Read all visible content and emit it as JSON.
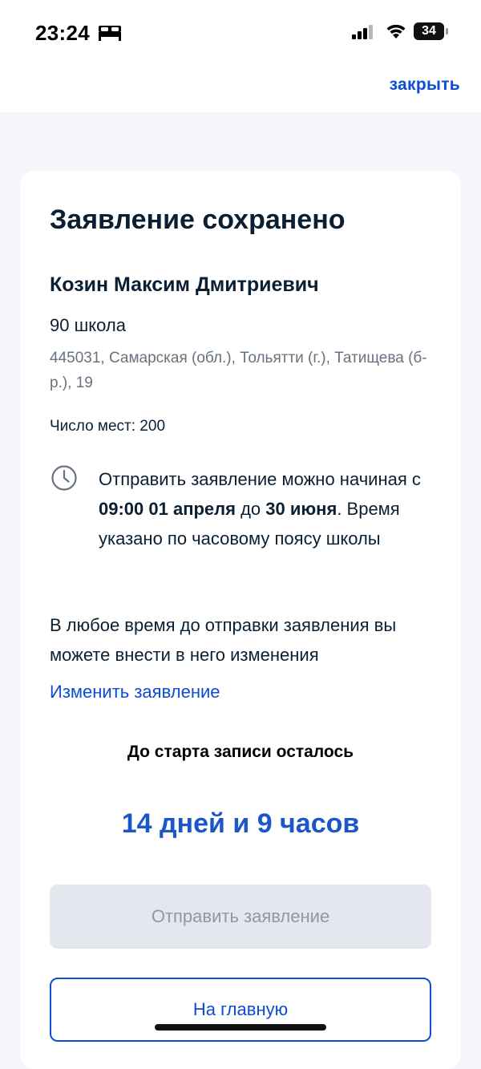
{
  "status_bar": {
    "time": "23:24",
    "battery": "34",
    "icons": [
      "bed-icon",
      "signal-icon",
      "wifi-icon",
      "battery-icon"
    ]
  },
  "topbar": {
    "close_label": "закрыть"
  },
  "card": {
    "title": "Заявление сохранено",
    "person_name": "Козин Максим Дмитриевич",
    "school_name": "90 школа",
    "address": "445031, Самарская (обл.), Тольятти (г.), Татищева (б-р.), 19",
    "seats": "Число мест: 200",
    "notice": {
      "prefix": "Отправить заявление можно начиная с ",
      "start": "09:00 01 апреля",
      "middle": " до ",
      "end": "30 июня",
      "suffix": ". Время указано по часовому поясу школы"
    },
    "change_note": "В любое время до отправки заявления вы можете внести в него изменения",
    "change_link": "Изменить заявление",
    "countdown_label": "До старта записи осталось",
    "countdown_value": "14 дней и 9 часов",
    "submit_label": "Отправить заявление",
    "home_label": "На главную"
  },
  "colors": {
    "accent": "#0d4cd3",
    "countdown": "#1c57c7",
    "text": "#0b1f33",
    "muted": "#66727f",
    "disabled_bg": "#e4e8ee",
    "disabled_text": "#8d99a6",
    "page_bg": "#f4f6fb"
  }
}
